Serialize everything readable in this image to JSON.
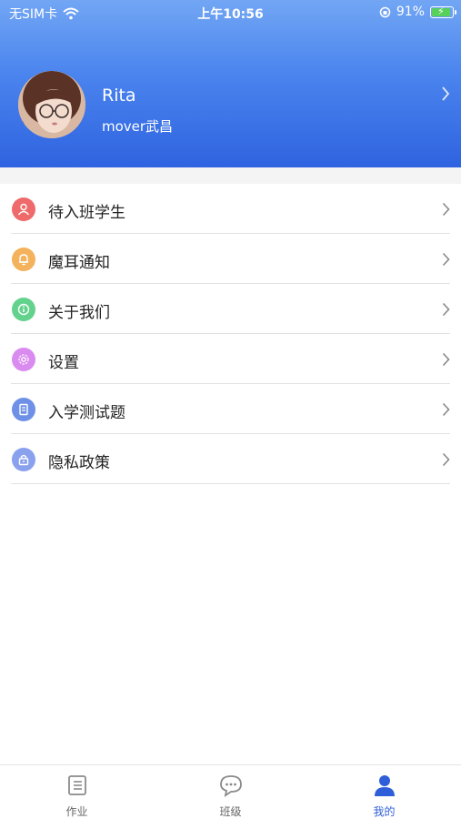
{
  "status_bar": {
    "carrier": "无SIM卡",
    "time": "上午10:56",
    "battery": "91%",
    "battery_level": 0.91
  },
  "profile": {
    "name": "Rita",
    "subtitle": "mover武昌"
  },
  "menu": {
    "items": [
      {
        "label": "待入班学生",
        "icon": "person-icon",
        "color": "#ef6b6b"
      },
      {
        "label": "魔耳通知",
        "icon": "bell-icon",
        "color": "#f3b25b"
      },
      {
        "label": "关于我们",
        "icon": "info-icon",
        "color": "#63d28c"
      },
      {
        "label": "设置",
        "icon": "gear-icon",
        "color": "#d98bf0"
      },
      {
        "label": "入学测试题",
        "icon": "document-icon",
        "color": "#6e90e6"
      },
      {
        "label": "隐私政策",
        "icon": "lock-icon",
        "color": "#8aa1ee"
      }
    ]
  },
  "tabbar": {
    "tabs": [
      {
        "label": "作业",
        "icon": "homework-icon",
        "active": false
      },
      {
        "label": "班级",
        "icon": "chat-icon",
        "active": false
      },
      {
        "label": "我的",
        "icon": "profile-icon",
        "active": true
      }
    ]
  },
  "colors": {
    "header_top": "#72a6f4",
    "header_bottom": "#2f63e0",
    "active_tab": "#2f5fd8"
  }
}
